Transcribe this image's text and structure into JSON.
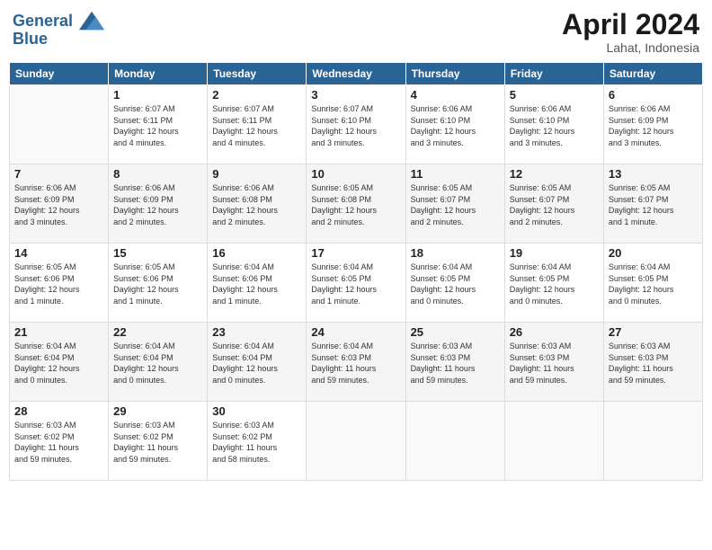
{
  "header": {
    "logo_line1": "General",
    "logo_line2": "Blue",
    "month": "April 2024",
    "location": "Lahat, Indonesia"
  },
  "days_of_week": [
    "Sunday",
    "Monday",
    "Tuesday",
    "Wednesday",
    "Thursday",
    "Friday",
    "Saturday"
  ],
  "weeks": [
    [
      {
        "day": "",
        "info": ""
      },
      {
        "day": "1",
        "info": "Sunrise: 6:07 AM\nSunset: 6:11 PM\nDaylight: 12 hours\nand 4 minutes."
      },
      {
        "day": "2",
        "info": "Sunrise: 6:07 AM\nSunset: 6:11 PM\nDaylight: 12 hours\nand 4 minutes."
      },
      {
        "day": "3",
        "info": "Sunrise: 6:07 AM\nSunset: 6:10 PM\nDaylight: 12 hours\nand 3 minutes."
      },
      {
        "day": "4",
        "info": "Sunrise: 6:06 AM\nSunset: 6:10 PM\nDaylight: 12 hours\nand 3 minutes."
      },
      {
        "day": "5",
        "info": "Sunrise: 6:06 AM\nSunset: 6:10 PM\nDaylight: 12 hours\nand 3 minutes."
      },
      {
        "day": "6",
        "info": "Sunrise: 6:06 AM\nSunset: 6:09 PM\nDaylight: 12 hours\nand 3 minutes."
      }
    ],
    [
      {
        "day": "7",
        "info": "Sunrise: 6:06 AM\nSunset: 6:09 PM\nDaylight: 12 hours\nand 3 minutes."
      },
      {
        "day": "8",
        "info": "Sunrise: 6:06 AM\nSunset: 6:09 PM\nDaylight: 12 hours\nand 2 minutes."
      },
      {
        "day": "9",
        "info": "Sunrise: 6:06 AM\nSunset: 6:08 PM\nDaylight: 12 hours\nand 2 minutes."
      },
      {
        "day": "10",
        "info": "Sunrise: 6:05 AM\nSunset: 6:08 PM\nDaylight: 12 hours\nand 2 minutes."
      },
      {
        "day": "11",
        "info": "Sunrise: 6:05 AM\nSunset: 6:07 PM\nDaylight: 12 hours\nand 2 minutes."
      },
      {
        "day": "12",
        "info": "Sunrise: 6:05 AM\nSunset: 6:07 PM\nDaylight: 12 hours\nand 2 minutes."
      },
      {
        "day": "13",
        "info": "Sunrise: 6:05 AM\nSunset: 6:07 PM\nDaylight: 12 hours\nand 1 minute."
      }
    ],
    [
      {
        "day": "14",
        "info": "Sunrise: 6:05 AM\nSunset: 6:06 PM\nDaylight: 12 hours\nand 1 minute."
      },
      {
        "day": "15",
        "info": "Sunrise: 6:05 AM\nSunset: 6:06 PM\nDaylight: 12 hours\nand 1 minute."
      },
      {
        "day": "16",
        "info": "Sunrise: 6:04 AM\nSunset: 6:06 PM\nDaylight: 12 hours\nand 1 minute."
      },
      {
        "day": "17",
        "info": "Sunrise: 6:04 AM\nSunset: 6:05 PM\nDaylight: 12 hours\nand 1 minute."
      },
      {
        "day": "18",
        "info": "Sunrise: 6:04 AM\nSunset: 6:05 PM\nDaylight: 12 hours\nand 0 minutes."
      },
      {
        "day": "19",
        "info": "Sunrise: 6:04 AM\nSunset: 6:05 PM\nDaylight: 12 hours\nand 0 minutes."
      },
      {
        "day": "20",
        "info": "Sunrise: 6:04 AM\nSunset: 6:05 PM\nDaylight: 12 hours\nand 0 minutes."
      }
    ],
    [
      {
        "day": "21",
        "info": "Sunrise: 6:04 AM\nSunset: 6:04 PM\nDaylight: 12 hours\nand 0 minutes."
      },
      {
        "day": "22",
        "info": "Sunrise: 6:04 AM\nSunset: 6:04 PM\nDaylight: 12 hours\nand 0 minutes."
      },
      {
        "day": "23",
        "info": "Sunrise: 6:04 AM\nSunset: 6:04 PM\nDaylight: 12 hours\nand 0 minutes."
      },
      {
        "day": "24",
        "info": "Sunrise: 6:04 AM\nSunset: 6:03 PM\nDaylight: 11 hours\nand 59 minutes."
      },
      {
        "day": "25",
        "info": "Sunrise: 6:03 AM\nSunset: 6:03 PM\nDaylight: 11 hours\nand 59 minutes."
      },
      {
        "day": "26",
        "info": "Sunrise: 6:03 AM\nSunset: 6:03 PM\nDaylight: 11 hours\nand 59 minutes."
      },
      {
        "day": "27",
        "info": "Sunrise: 6:03 AM\nSunset: 6:03 PM\nDaylight: 11 hours\nand 59 minutes."
      }
    ],
    [
      {
        "day": "28",
        "info": "Sunrise: 6:03 AM\nSunset: 6:02 PM\nDaylight: 11 hours\nand 59 minutes."
      },
      {
        "day": "29",
        "info": "Sunrise: 6:03 AM\nSunset: 6:02 PM\nDaylight: 11 hours\nand 59 minutes."
      },
      {
        "day": "30",
        "info": "Sunrise: 6:03 AM\nSunset: 6:02 PM\nDaylight: 11 hours\nand 58 minutes."
      },
      {
        "day": "",
        "info": ""
      },
      {
        "day": "",
        "info": ""
      },
      {
        "day": "",
        "info": ""
      },
      {
        "day": "",
        "info": ""
      }
    ]
  ]
}
